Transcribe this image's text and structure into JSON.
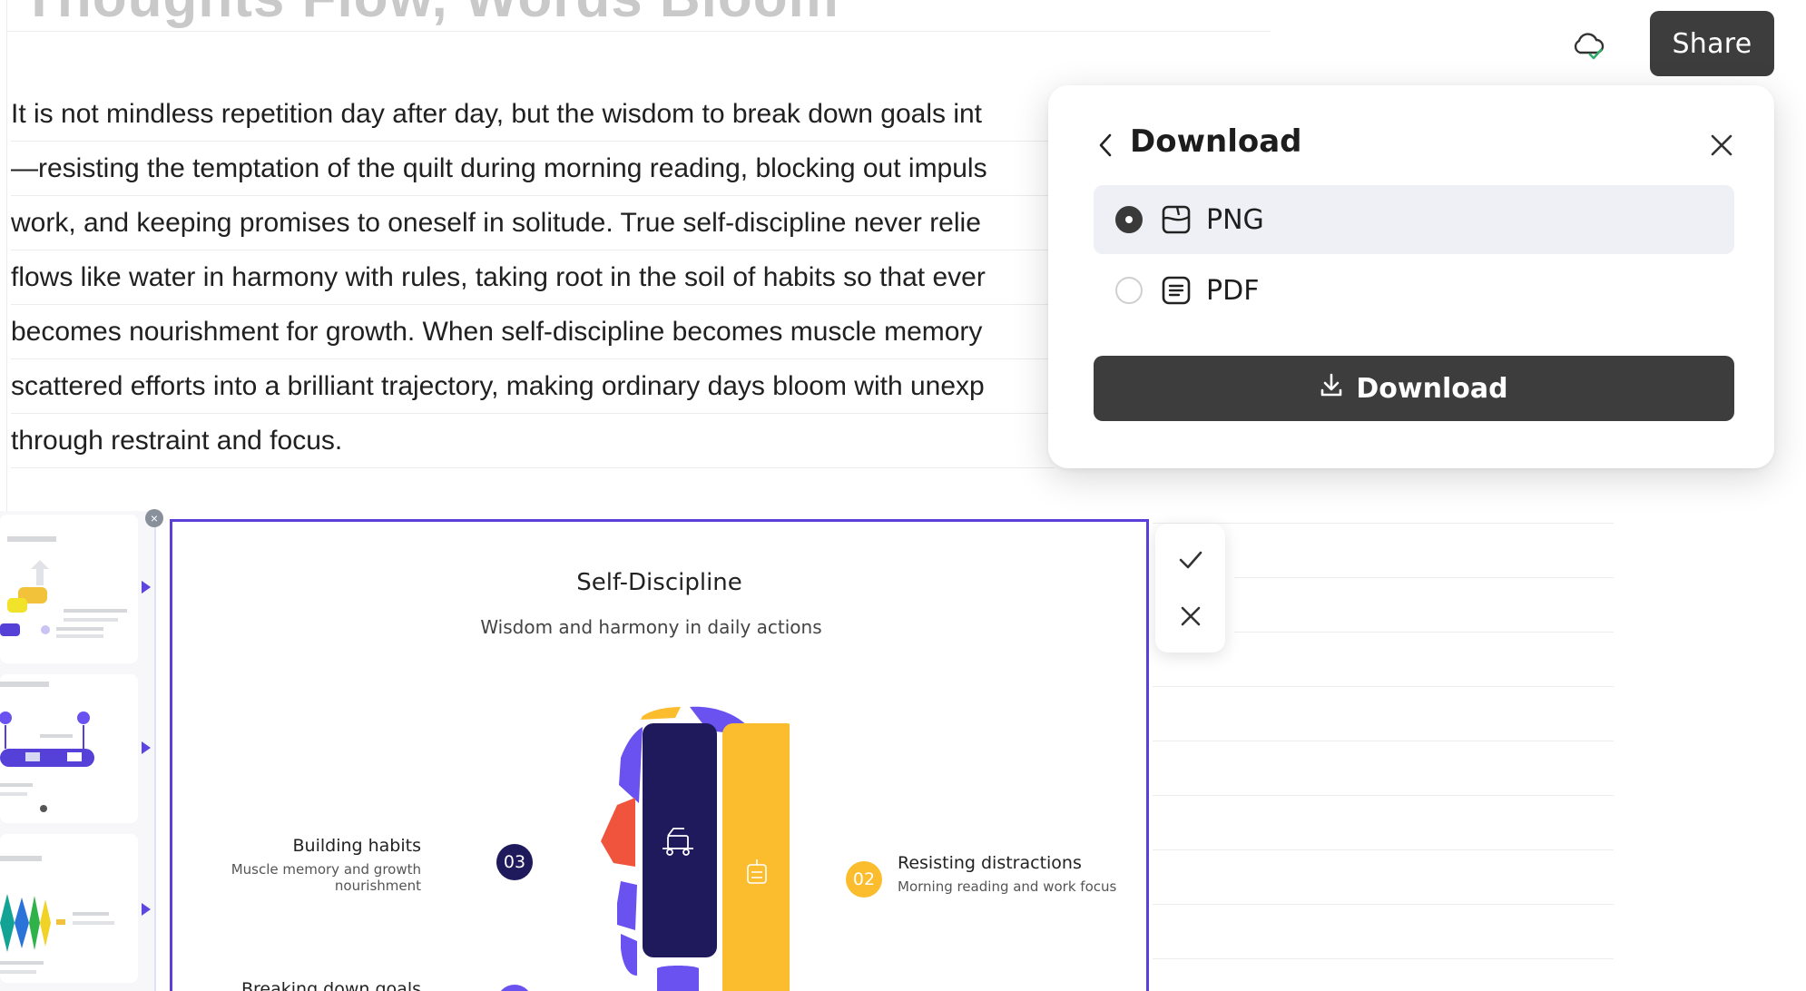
{
  "header": {
    "doc_title_partial": "Thoughts Flow, Words Bloom",
    "share_label": "Share"
  },
  "paragraph": {
    "lines": [
      "It is not mindless repetition day after day, but the wisdom to break down goals int",
      "—resisting the temptation of the quilt during morning reading, blocking out impuls",
      "work, and keeping promises to oneself in solitude. True self-discipline never relie",
      "flows like water in harmony with rules, taking root in the soil of habits so that ever",
      "becomes nourishment for growth. When self-discipline becomes muscle memory",
      "scattered efforts into a brilliant trajectory, making ordinary days bloom with unexp",
      "through restraint and focus."
    ]
  },
  "download_panel": {
    "title": "Download",
    "options": [
      {
        "label": "PNG",
        "selected": true,
        "icon": "image-icon"
      },
      {
        "label": "PDF",
        "selected": false,
        "icon": "document-icon"
      }
    ],
    "button_label": "Download"
  },
  "infographic": {
    "title": "Self-Discipline",
    "subtitle": "Wisdom and harmony in daily actions",
    "items": [
      {
        "number": "03",
        "title": "Building habits",
        "subtitle": "Muscle memory and growth nourishment",
        "color": "#1f1a5c"
      },
      {
        "number": "02",
        "title": "Resisting distractions",
        "subtitle": "Morning reading and work focus",
        "color": "#fbbd2e"
      },
      {
        "number": "",
        "title": "Breaking down goals",
        "subtitle": "",
        "color": "#6a52f0"
      }
    ],
    "palette": {
      "navy": "#1f1a5c",
      "yellow": "#fbbd2e",
      "purple": "#6a52f0",
      "red": "#f0543c"
    }
  },
  "colors": {
    "accent": "#5b3fd8",
    "button_dark": "#3d3d3d"
  }
}
